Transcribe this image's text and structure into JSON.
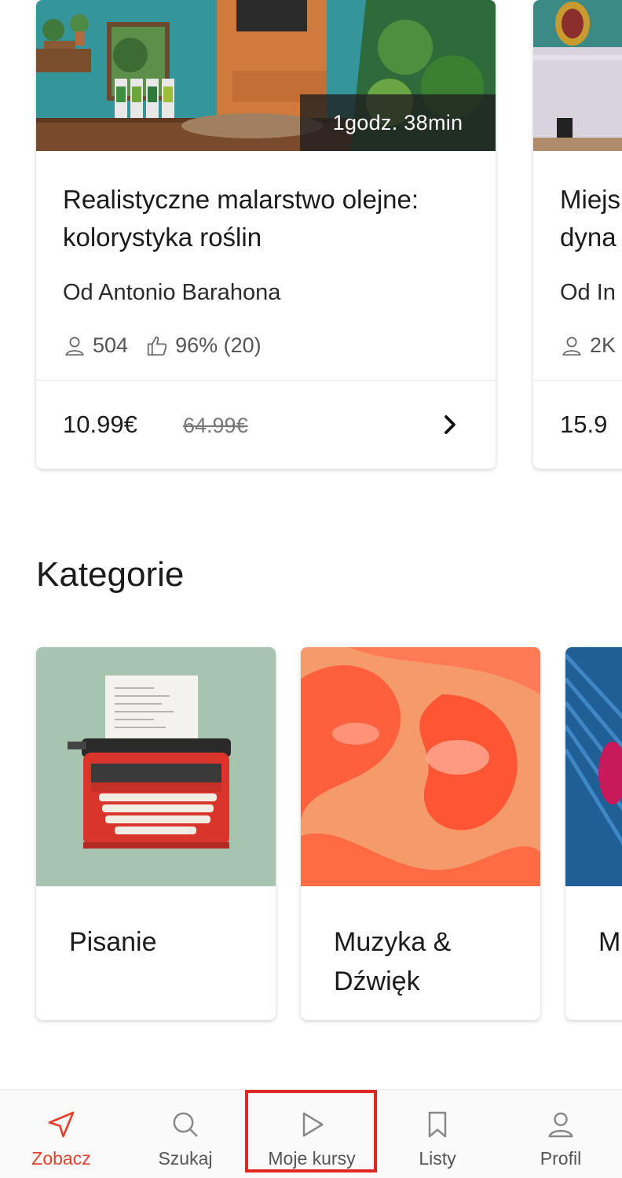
{
  "courses": [
    {
      "duration": "1godz. 38min",
      "title": "Realistyczne malarstwo olejne: kolorystyka roślin",
      "author": "Od Antonio Barahona",
      "students": "504",
      "rating": "96% (20)",
      "price": "10.99€",
      "old_price": "64.99€"
    },
    {
      "title": "Miejs dyna",
      "author": "Od In",
      "students": "2K",
      "price": "15.9"
    }
  ],
  "categories_section": {
    "title": "Kategorie",
    "items": [
      {
        "label": "Pisanie"
      },
      {
        "label": "Muzyka & Dźwięk"
      },
      {
        "label": "M"
      }
    ]
  },
  "bottom_nav": {
    "items": [
      {
        "label": "Zobacz",
        "icon": "send-icon"
      },
      {
        "label": "Szukaj",
        "icon": "search-icon"
      },
      {
        "label": "Moje kursy",
        "icon": "play-icon"
      },
      {
        "label": "Listy",
        "icon": "bookmark-icon"
      },
      {
        "label": "Profil",
        "icon": "user-icon"
      }
    ],
    "active_color": "#e8402a"
  }
}
